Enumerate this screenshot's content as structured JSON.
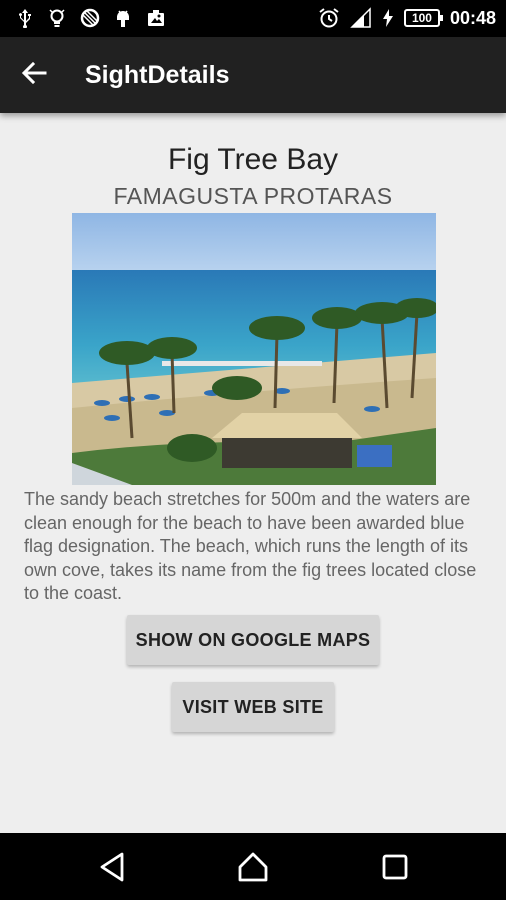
{
  "status_bar": {
    "icons_left": [
      "usb-icon",
      "lightbulb-icon",
      "data-saver-icon",
      "android-debug-icon",
      "photo-icon"
    ],
    "battery_level": "100",
    "time": "00:48"
  },
  "app_bar": {
    "title": "SightDetails",
    "back_icon": "arrow-back-icon"
  },
  "sight": {
    "title": "Fig Tree Bay",
    "location": "FAMAGUSTA PROTARAS",
    "description": "The sandy beach stretches for 500m and the waters are clean enough for the beach to have been awarded blue flag designation. The beach, which runs the length of its own cove, takes its name from the fig trees located close to the coast."
  },
  "buttons": {
    "maps_label": "SHOW ON GOOGLE MAPS",
    "website_label": "VISIT WEB SITE"
  },
  "nav_bar": {
    "icons": [
      "back-triangle-icon",
      "home-icon",
      "recents-icon"
    ]
  }
}
